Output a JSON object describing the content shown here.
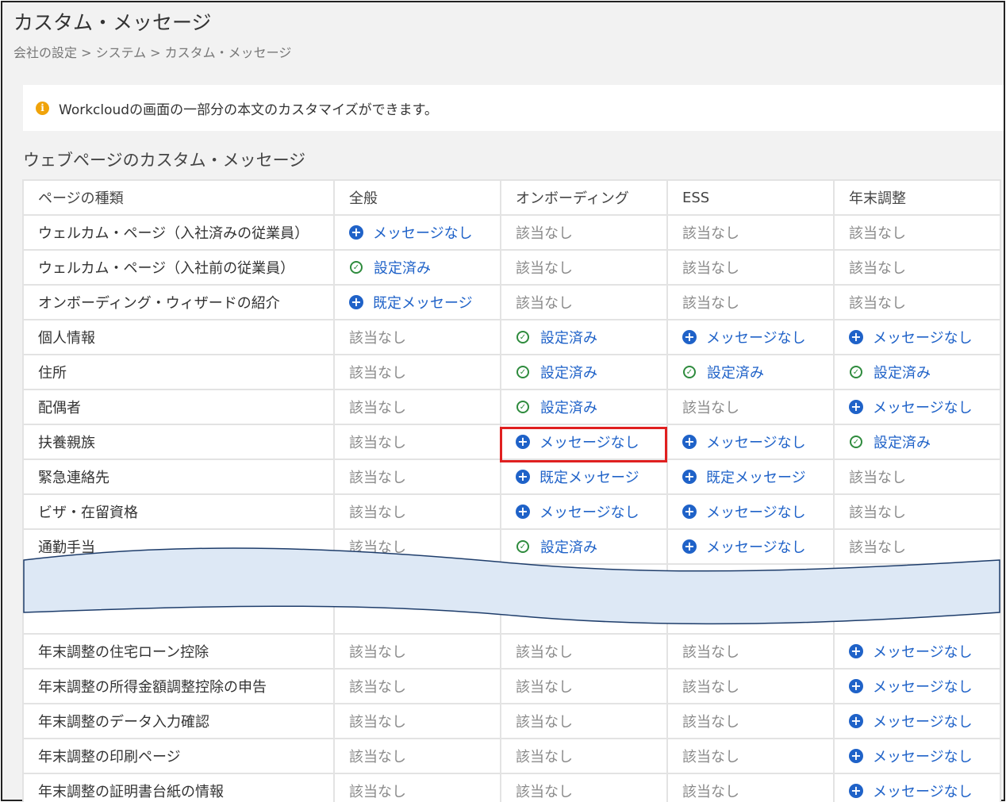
{
  "page": {
    "title": "カスタム・メッセージ",
    "breadcrumb": "会社の設定 > システム > カスタム・メッセージ",
    "info_text": "Workcloudの画面の一部分の本文のカスタマイズができます。",
    "section_title": "ウェブページのカスタム・メッセージ"
  },
  "colors": {
    "link": "#1f62c8",
    "check": "#2e8b3d",
    "highlight": "#e02020",
    "info": "#f0a30a",
    "wave_fill": "#dde8f5",
    "wave_stroke": "#1e3d6b"
  },
  "icons": {
    "info": "info-circle-icon",
    "add": "plus-circle-icon",
    "done": "check-circle-icon"
  },
  "table": {
    "headers": [
      "ページの種類",
      "全般",
      "オンボーディング",
      "ESS",
      "年末調整"
    ],
    "rows": [
      [
        "ウェルカム・ページ（入社済みの従業員）",
        "メッセージなし",
        "該当なし",
        "該当なし",
        "該当なし"
      ],
      [
        "ウェルカム・ページ（入社前の従業員）",
        "設定済み",
        "該当なし",
        "該当なし",
        "該当なし"
      ],
      [
        "オンボーディング・ウィザードの紹介",
        "既定メッセージ",
        "該当なし",
        "該当なし",
        "該当なし"
      ],
      [
        "個人情報",
        "該当なし",
        "設定済み",
        "メッセージなし",
        "メッセージなし"
      ],
      [
        "住所",
        "該当なし",
        "設定済み",
        "設定済み",
        "設定済み"
      ],
      [
        "配偶者",
        "該当なし",
        "設定済み",
        "該当なし",
        "メッセージなし"
      ],
      [
        "扶養親族",
        "該当なし",
        "メッセージなし",
        "メッセージなし",
        "設定済み"
      ],
      [
        "緊急連絡先",
        "該当なし",
        "既定メッセージ",
        "既定メッセージ",
        "該当なし"
      ],
      [
        "ビザ・在留資格",
        "該当なし",
        "メッセージなし",
        "メッセージなし",
        "該当なし"
      ],
      [
        "通勤手当",
        "該当なし",
        "設定済み",
        "メッセージなし",
        "該当なし"
      ],
      [
        "",
        "",
        "",
        "",
        ""
      ],
      [
        "年末調整の住宅ローン控除",
        "該当なし",
        "該当なし",
        "該当なし",
        "メッセージなし"
      ],
      [
        "年末調整の所得金額調整控除の申告",
        "該当なし",
        "該当なし",
        "該当なし",
        "メッセージなし"
      ],
      [
        "年末調整のデータ入力確認",
        "該当なし",
        "該当なし",
        "該当なし",
        "メッセージなし"
      ],
      [
        "年末調整の印刷ページ",
        "該当なし",
        "該当なし",
        "該当なし",
        "メッセージなし"
      ],
      [
        "年末調整の証明書台紙の情報",
        "該当なし",
        "該当なし",
        "該当なし",
        "メッセージなし"
      ]
    ]
  }
}
